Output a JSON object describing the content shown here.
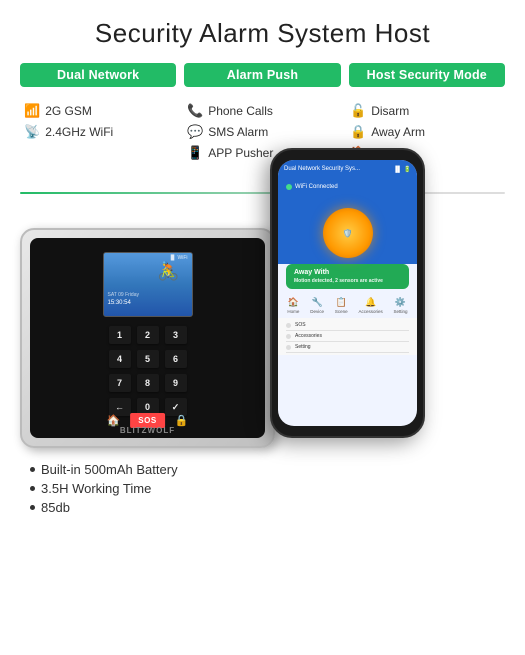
{
  "title": "Security Alarm System Host",
  "badges": [
    {
      "id": "dual-network",
      "label": "Dual Network"
    },
    {
      "id": "alarm-push",
      "label": "Alarm Push"
    },
    {
      "id": "host-security",
      "label": "Host Security Mode"
    }
  ],
  "features": {
    "dual_network": [
      {
        "icon": "📶",
        "text": "2G GSM"
      },
      {
        "icon": "📡",
        "text": "2.4GHz WiFi"
      }
    ],
    "alarm_push": [
      {
        "icon": "📞",
        "text": "Phone Calls"
      },
      {
        "icon": "💬",
        "text": "SMS Alarm"
      },
      {
        "icon": "📱",
        "text": "APP Pusher"
      }
    ],
    "host_security": [
      {
        "icon": "🔒",
        "text": "Disarm"
      },
      {
        "icon": "🔒",
        "text": "Away Arm"
      },
      {
        "icon": "🏠",
        "text": "Home"
      },
      {
        "icon": "🆘",
        "text": "SOS"
      }
    ]
  },
  "keypad": {
    "keys": [
      "1",
      "2",
      "3",
      "4",
      "5",
      "6",
      "7",
      "8",
      "9",
      "←",
      "0",
      "✓"
    ]
  },
  "device": {
    "brand": "BLITZWOLF",
    "lcd_icon": "🚴"
  },
  "phone": {
    "status": "Dual Network Security Sys...",
    "wifi_label": "WiFi Connected",
    "circle_label": "Away With",
    "arm_title": "Away With",
    "arm_subtitle": "Motion detected, 2 sensors are active",
    "nav_items": [
      {
        "icon": "🏠",
        "label": "Home"
      },
      {
        "icon": "🔧",
        "label": "Device"
      },
      {
        "icon": "📋",
        "label": "Scene"
      },
      {
        "icon": "🔔",
        "label": "Accessories"
      },
      {
        "icon": "⚙️",
        "label": "Setting"
      }
    ],
    "list_items": [
      {
        "text": "SOS"
      },
      {
        "text": "Accessories"
      },
      {
        "text": "Setting"
      }
    ]
  },
  "bullets": [
    "Built-in 500mAh Battery",
    "3.5H Working Time",
    "85db"
  ],
  "colors": {
    "brand_green": "#22bb66",
    "accent_blue": "#2266cc"
  }
}
